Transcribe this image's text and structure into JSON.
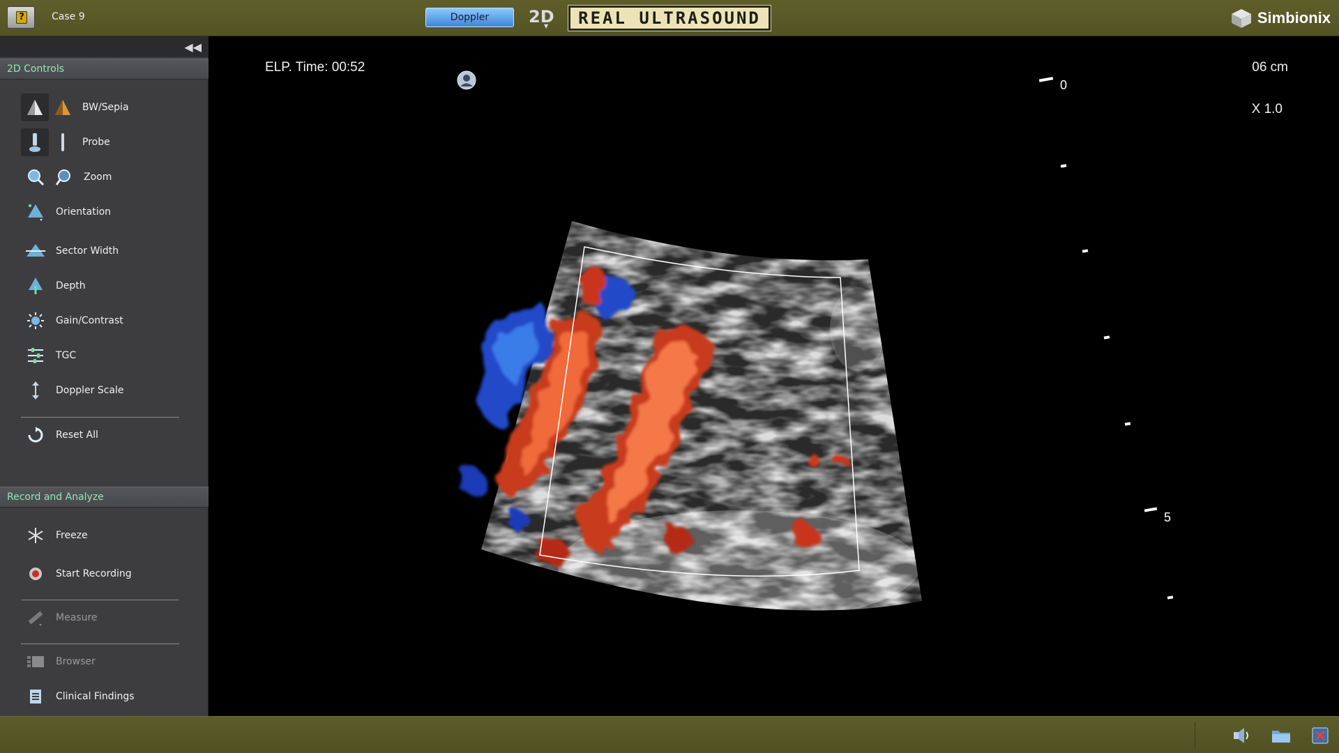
{
  "topbar": {
    "case_label": "Case 9",
    "doppler_label": "Doppler",
    "mode_label": "2D",
    "brand_badge": "REAL ULTRASOUND",
    "vendor_name": "Simbionix"
  },
  "sidebar": {
    "controls_header": "2D Controls",
    "controls": [
      {
        "label": "BW/Sepia",
        "icon": "bw-sepia-icon"
      },
      {
        "label": "Probe",
        "icon": "probe-icon"
      },
      {
        "label": "Zoom",
        "icon": "zoom-icon"
      },
      {
        "label": "Orientation",
        "icon": "orientation-icon"
      },
      {
        "label": "Sector Width",
        "icon": "sector-width-icon"
      },
      {
        "label": "Depth",
        "icon": "depth-icon"
      },
      {
        "label": "Gain/Contrast",
        "icon": "gain-contrast-icon"
      },
      {
        "label": "TGC",
        "icon": "tgc-icon"
      },
      {
        "label": "Doppler Scale",
        "icon": "doppler-scale-icon"
      },
      {
        "label": "Reset All",
        "icon": "reset-icon"
      }
    ],
    "record_header": "Record and Analyze",
    "record_items": [
      {
        "label": "Freeze",
        "icon": "snowflake-icon"
      },
      {
        "label": "Start Recording",
        "icon": "record-icon"
      },
      {
        "label": "Measure",
        "icon": "ruler-icon"
      },
      {
        "label": "Browser",
        "icon": "browser-icon"
      },
      {
        "label": "Clinical Findings",
        "icon": "document-icon"
      }
    ]
  },
  "viewport": {
    "elapsed_time": "ELP. Time: 00:52",
    "depth": "06 cm",
    "zoom": "X 1.0",
    "scale_top": "0",
    "scale_mid": "5"
  },
  "colors": {
    "topbar": "#58572a",
    "sidebar": "#3d3d3f",
    "section_header_text": "#8fe7b8",
    "doppler_button": "#5aa2ec",
    "doppler_red": "#e8461f",
    "doppler_blue": "#2a50d8"
  }
}
